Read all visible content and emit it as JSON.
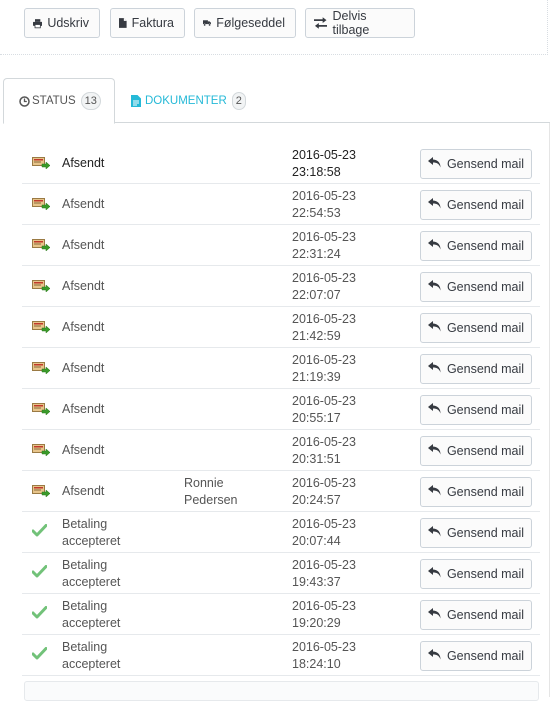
{
  "toolbar": {
    "print_label": "Udskriv",
    "invoice_label": "Faktura",
    "delivery_slip_label": "Følgeseddel",
    "partial_refund_label": "Delvis tilbage"
  },
  "tabs": {
    "status": {
      "label": "STATUS",
      "count": "13"
    },
    "documents": {
      "label": "DOKUMENTER",
      "count": "2"
    }
  },
  "history": [
    {
      "status": [
        "Afsendt"
      ],
      "employee": [],
      "date": "2016-05-23",
      "time": "23:18:58",
      "icon": "shipped-icon",
      "current": true
    },
    {
      "status": [
        "Afsendt"
      ],
      "employee": [],
      "date": "2016-05-23",
      "time": "22:54:53",
      "icon": "shipped-icon",
      "current": false
    },
    {
      "status": [
        "Afsendt"
      ],
      "employee": [],
      "date": "2016-05-23",
      "time": "22:31:24",
      "icon": "shipped-icon",
      "current": false
    },
    {
      "status": [
        "Afsendt"
      ],
      "employee": [],
      "date": "2016-05-23",
      "time": "22:07:07",
      "icon": "shipped-icon",
      "current": false
    },
    {
      "status": [
        "Afsendt"
      ],
      "employee": [],
      "date": "2016-05-23",
      "time": "21:42:59",
      "icon": "shipped-icon",
      "current": false
    },
    {
      "status": [
        "Afsendt"
      ],
      "employee": [],
      "date": "2016-05-23",
      "time": "21:19:39",
      "icon": "shipped-icon",
      "current": false
    },
    {
      "status": [
        "Afsendt"
      ],
      "employee": [],
      "date": "2016-05-23",
      "time": "20:55:17",
      "icon": "shipped-icon",
      "current": false
    },
    {
      "status": [
        "Afsendt"
      ],
      "employee": [],
      "date": "2016-05-23",
      "time": "20:31:51",
      "icon": "shipped-icon",
      "current": false
    },
    {
      "status": [
        "Afsendt"
      ],
      "employee": [
        "Ronnie",
        "Pedersen"
      ],
      "date": "2016-05-23",
      "time": "20:24:57",
      "icon": "shipped-icon",
      "current": false
    },
    {
      "status": [
        "Betaling",
        "accepteret"
      ],
      "employee": [],
      "date": "2016-05-23",
      "time": "20:07:44",
      "icon": "check-icon",
      "current": false
    },
    {
      "status": [
        "Betaling",
        "accepteret"
      ],
      "employee": [],
      "date": "2016-05-23",
      "time": "19:43:37",
      "icon": "check-icon",
      "current": false
    },
    {
      "status": [
        "Betaling",
        "accepteret"
      ],
      "employee": [],
      "date": "2016-05-23",
      "time": "19:20:29",
      "icon": "check-icon",
      "current": false
    },
    {
      "status": [
        "Betaling",
        "accepteret"
      ],
      "employee": [],
      "date": "2016-05-23",
      "time": "18:24:10",
      "icon": "check-icon",
      "current": false
    }
  ],
  "resend_label": "Gensend mail",
  "colors": {
    "accent": "#25b9d7",
    "check": "#72c279",
    "text": "#555555"
  }
}
